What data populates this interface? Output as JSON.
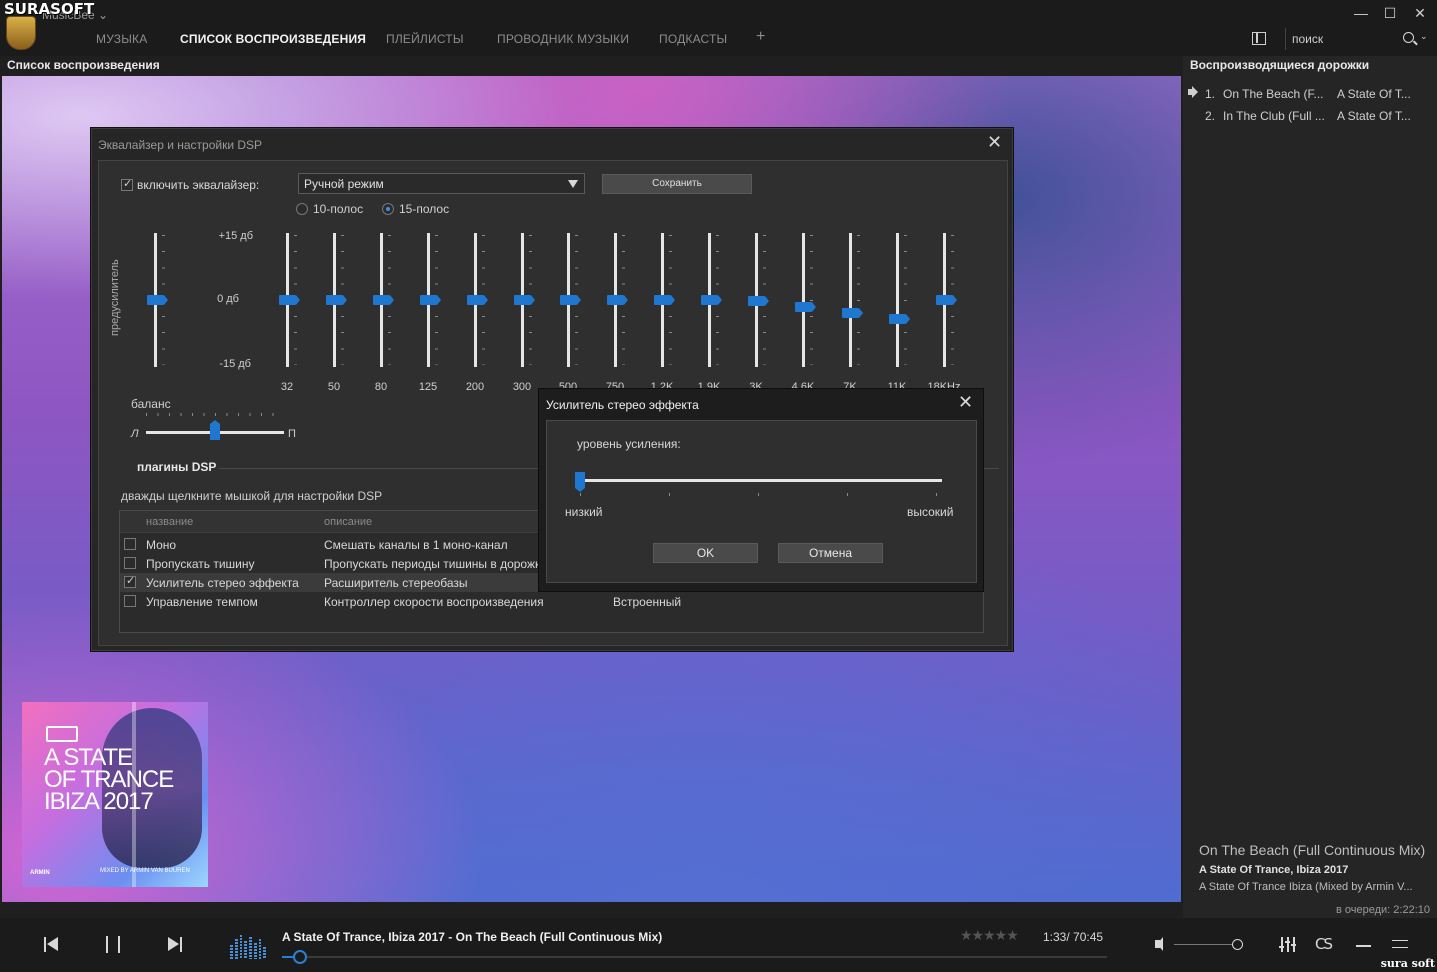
{
  "brand": {
    "logo_text": "SURASOFT",
    "app_name": "MusicBee ⌄",
    "watermark": "sura soft"
  },
  "tabs": [
    {
      "label": "МУЗЫКА",
      "active": false
    },
    {
      "label": "СПИСОК ВОСПРОИЗВЕДЕНИЯ",
      "active": true
    },
    {
      "label": "ПЛЕЙЛИСТЫ",
      "active": false
    },
    {
      "label": "ПРОВОДНИК МУЗЫКИ",
      "active": false
    },
    {
      "label": "ПОДКАСТЫ",
      "active": false
    }
  ],
  "tab_add": "+",
  "window": {
    "minimize": "—",
    "maximize": "☐",
    "close": "✕"
  },
  "search": {
    "placeholder": "поиск",
    "icon": "search-icon"
  },
  "left_panel": {
    "title": "Список воспроизведения"
  },
  "album_art": {
    "line1": "A STATE",
    "line2": "OF TRANCE",
    "line3": "IBIZA 2017",
    "credit": "MIXED BY ARMIN VAN BUUREN",
    "brand": "ARMIN"
  },
  "right_panel": {
    "title": "Воспроизводящиеся дорожки",
    "tracks": [
      {
        "num": "1.",
        "title": "On The Beach (F...",
        "album": "A State Of T...",
        "playing": true
      },
      {
        "num": "2.",
        "title": "In The Club (Full ...",
        "album": "A State Of T...",
        "playing": false
      }
    ],
    "now_playing": {
      "title": "On The Beach (Full Continuous Mix)",
      "album": "A State Of Trance, Ibiza 2017",
      "sub": "A State Of Trance Ibiza (Mixed by Armin V..."
    },
    "queue": "в очереди: 2:22:10"
  },
  "player": {
    "track_text": "A State Of Trance, Ibiza 2017 - On The Beach (Full Continuous Mix)",
    "time": "1:33/ 70:45",
    "progress": 0.022,
    "rating": "★★★★★",
    "volume": 0.98,
    "scrobble_label": "CS"
  },
  "eq_dialog": {
    "title": "Эквалайзер и настройки DSP",
    "close": "✕",
    "enable_label": "включить эквалайзер:",
    "enabled": true,
    "mode": "Ручной режим",
    "save_label": "Сохранить",
    "bands_options": [
      {
        "label": "10-полос",
        "selected": false
      },
      {
        "label": "15-полос",
        "selected": true
      }
    ],
    "preamp_label": "предусилитель",
    "preamp_value": 0,
    "db_top": "+15 дб",
    "db_mid": "0 дб",
    "db_bottom": "-15 дб",
    "bands": [
      {
        "freq": "32",
        "value": 0
      },
      {
        "freq": "50",
        "value": 0
      },
      {
        "freq": "80",
        "value": 0
      },
      {
        "freq": "125",
        "value": 0
      },
      {
        "freq": "200",
        "value": 0
      },
      {
        "freq": "300",
        "value": 0
      },
      {
        "freq": "500",
        "value": 0
      },
      {
        "freq": "750",
        "value": 0
      },
      {
        "freq": "1.2K",
        "value": 0
      },
      {
        "freq": "1.9K",
        "value": 0
      },
      {
        "freq": "3K",
        "value": -0.3
      },
      {
        "freq": "4.6K",
        "value": -1.5
      },
      {
        "freq": "7K",
        "value": -2.8
      },
      {
        "freq": "11K",
        "value": -4.2
      },
      {
        "freq": "18KHz",
        "value": 0
      }
    ],
    "balance_label": "баланс",
    "balance_left": "Л",
    "balance_right": "П",
    "balance_value": 0,
    "dsp_heading": "плагины DSP",
    "dsp_hint": "дважды щелкните мышкой для настройки DSP",
    "dsp_columns": {
      "name": "название",
      "description": "описание"
    },
    "dsp_plugins": [
      {
        "name": "Моно",
        "description": "Смешать каналы в 1 моно-канал",
        "source": "",
        "checked": false,
        "selected": false
      },
      {
        "name": "Пропускать тишину",
        "description": "Пропускать периоды тишины в дорожк...",
        "source": "",
        "checked": false,
        "selected": false
      },
      {
        "name": "Усилитель стерео эффекта",
        "description": "Расширитель стереобазы",
        "source": "",
        "checked": true,
        "selected": true
      },
      {
        "name": "Управление темпом",
        "description": "Контроллер скорости воспроизведения",
        "source": "Встроенный",
        "checked": false,
        "selected": false
      }
    ]
  },
  "stereo_dialog": {
    "title": "Усилитель стерео эффекта",
    "close": "✕",
    "gain_label": "уровень усиления:",
    "gain_value": 0,
    "low_label": "низкий",
    "high_label": "высокий",
    "ok_label": "OK",
    "cancel_label": "Отмена"
  },
  "colors": {
    "accent": "#1f77d0",
    "background": "#1f1f1f"
  }
}
